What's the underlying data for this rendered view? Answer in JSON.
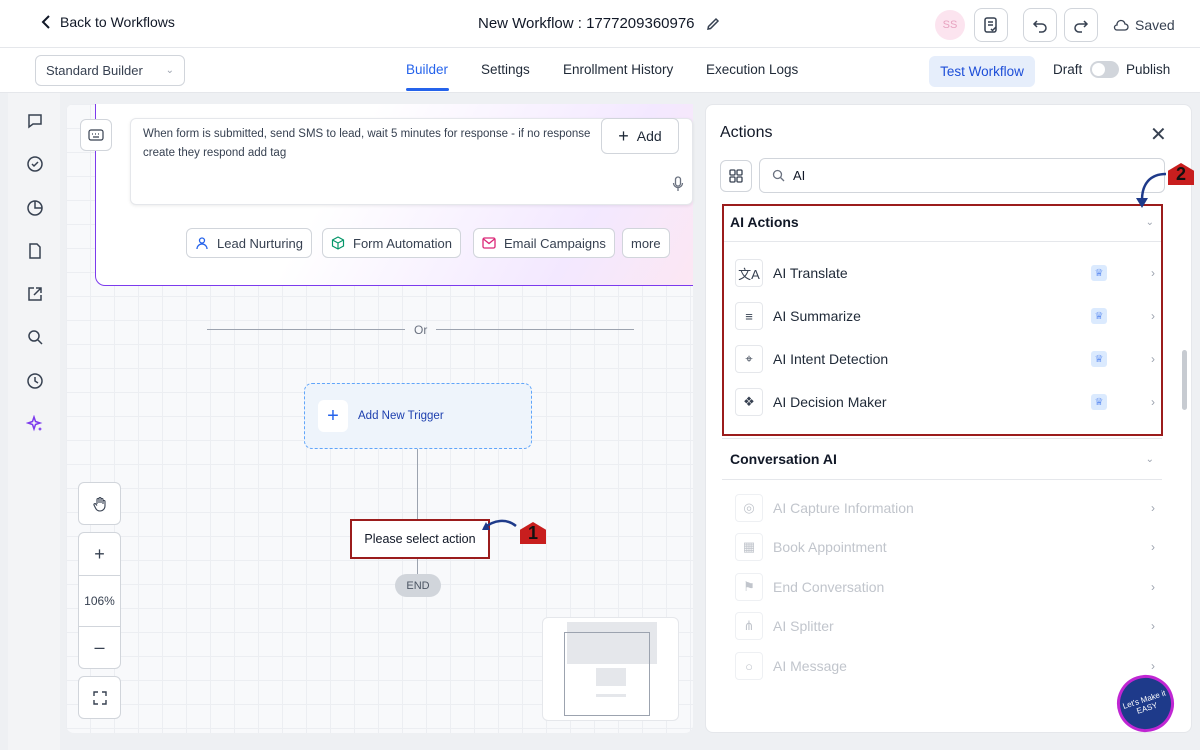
{
  "header": {
    "back_label": "Back to Workflows",
    "workflow_title": "New Workflow : 1777209360976",
    "avatar_initials": "SS",
    "saved_label": "Saved"
  },
  "tabs": {
    "builder_select": "Standard Builder",
    "items": [
      "Builder",
      "Settings",
      "Enrollment History",
      "Execution Logs"
    ],
    "active": "Builder",
    "test_workflow": "Test Workflow",
    "draft": "Draft",
    "publish": "Publish",
    "publish_toggle_on": false
  },
  "canvas": {
    "prompt_text": "When form is submitted, send SMS to lead, wait 5 minutes for response - if no response create they respond add tag",
    "add_label": "Add",
    "suggestions": [
      "Lead Nurturing",
      "Form Automation",
      "Email Campaigns",
      "more"
    ],
    "or_label": "Or",
    "add_trigger_label": "Add New Trigger",
    "action_node_label": "Please select action",
    "end_label": "END",
    "zoom_level": "106%"
  },
  "panel": {
    "title": "Actions",
    "search_value": "AI",
    "sections": [
      {
        "title": "AI Actions",
        "items": [
          {
            "label": "AI Translate",
            "icon": "translate-icon",
            "premium": true
          },
          {
            "label": "AI Summarize",
            "icon": "lines-icon",
            "premium": true
          },
          {
            "label": "AI Intent Detection",
            "icon": "intent-icon",
            "premium": true
          },
          {
            "label": "AI Decision Maker",
            "icon": "brain-icon",
            "premium": true
          }
        ]
      },
      {
        "title": "Conversation AI",
        "items": [
          {
            "label": "AI Capture Information",
            "icon": "target-icon"
          },
          {
            "label": "Book Appointment",
            "icon": "calendar-icon"
          },
          {
            "label": "End Conversation",
            "icon": "flag-icon"
          },
          {
            "label": "AI Splitter",
            "icon": "split-icon"
          },
          {
            "label": "AI Message",
            "icon": "message-icon"
          }
        ]
      }
    ]
  },
  "annotations": {
    "step1": "1",
    "step2": "2"
  },
  "watermark": "Let's Make it EASY",
  "colors": {
    "accent": "#2563eb",
    "highlight": "#9b1c1c",
    "prompt_border": "#7c3aed"
  }
}
